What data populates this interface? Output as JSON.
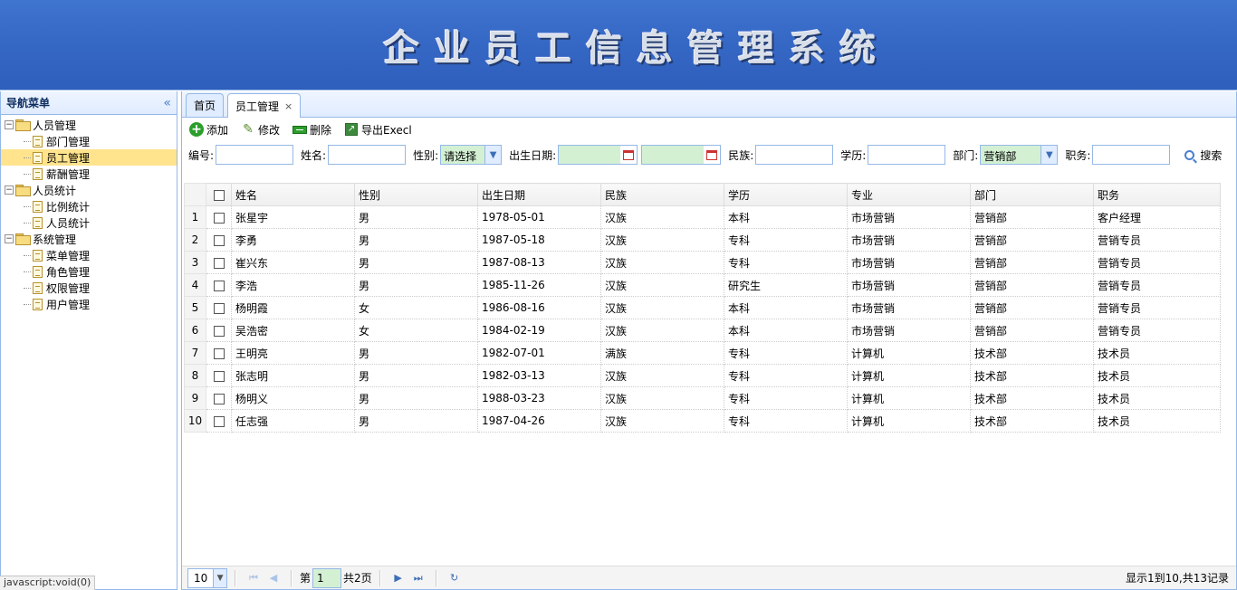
{
  "banner": {
    "title": "企业员工信息管理系统"
  },
  "sidebar": {
    "title": "导航菜单",
    "groups": [
      {
        "label": "人员管理",
        "items": [
          "部门管理",
          "员工管理",
          "薪酬管理"
        ]
      },
      {
        "label": "人员统计",
        "items": [
          "比例统计",
          "人员统计"
        ]
      },
      {
        "label": "系统管理",
        "items": [
          "菜单管理",
          "角色管理",
          "权限管理",
          "用户管理"
        ]
      }
    ],
    "selected": "员工管理"
  },
  "tabs": [
    {
      "label": "首页",
      "active": false
    },
    {
      "label": "员工管理",
      "active": true,
      "close": "×"
    }
  ],
  "toolbar": {
    "add": "添加",
    "edit": "修改",
    "delete": "删除",
    "export": "导出Execl"
  },
  "filters": {
    "id_label": "编号:",
    "name_label": "姓名:",
    "gender_label": "性别:",
    "gender_value": "请选择",
    "birth_label": "出生日期:",
    "nation_label": "民族:",
    "edu_label": "学历:",
    "dept_label": "部门:",
    "dept_value": "营销部",
    "job_label": "职务:",
    "search": "搜索"
  },
  "table": {
    "headers": [
      "姓名",
      "性别",
      "出生日期",
      "民族",
      "学历",
      "专业",
      "部门",
      "职务"
    ],
    "rows": [
      [
        "张星宇",
        "男",
        "1978-05-01",
        "汉族",
        "本科",
        "市场营销",
        "营销部",
        "客户经理"
      ],
      [
        "李勇",
        "男",
        "1987-05-18",
        "汉族",
        "专科",
        "市场营销",
        "营销部",
        "营销专员"
      ],
      [
        "崔兴东",
        "男",
        "1987-08-13",
        "汉族",
        "专科",
        "市场营销",
        "营销部",
        "营销专员"
      ],
      [
        "李浩",
        "男",
        "1985-11-26",
        "汉族",
        "研究生",
        "市场营销",
        "营销部",
        "营销专员"
      ],
      [
        "杨明霞",
        "女",
        "1986-08-16",
        "汉族",
        "本科",
        "市场营销",
        "营销部",
        "营销专员"
      ],
      [
        "吴浩密",
        "女",
        "1984-02-19",
        "汉族",
        "本科",
        "市场营销",
        "营销部",
        "营销专员"
      ],
      [
        "王明亮",
        "男",
        "1982-07-01",
        "满族",
        "专科",
        "计算机",
        "技术部",
        "技术员"
      ],
      [
        "张志明",
        "男",
        "1982-03-13",
        "汉族",
        "专科",
        "计算机",
        "技术部",
        "技术员"
      ],
      [
        "杨明义",
        "男",
        "1988-03-23",
        "汉族",
        "专科",
        "计算机",
        "技术部",
        "技术员"
      ],
      [
        "任志强",
        "男",
        "1987-04-26",
        "汉族",
        "专科",
        "计算机",
        "技术部",
        "技术员"
      ]
    ]
  },
  "pager": {
    "page_size": "10",
    "page_prefix": "第",
    "page": "1",
    "page_suffix": "共2页",
    "info": "显示1到10,共13记录"
  },
  "status": "javascript:void(0)"
}
